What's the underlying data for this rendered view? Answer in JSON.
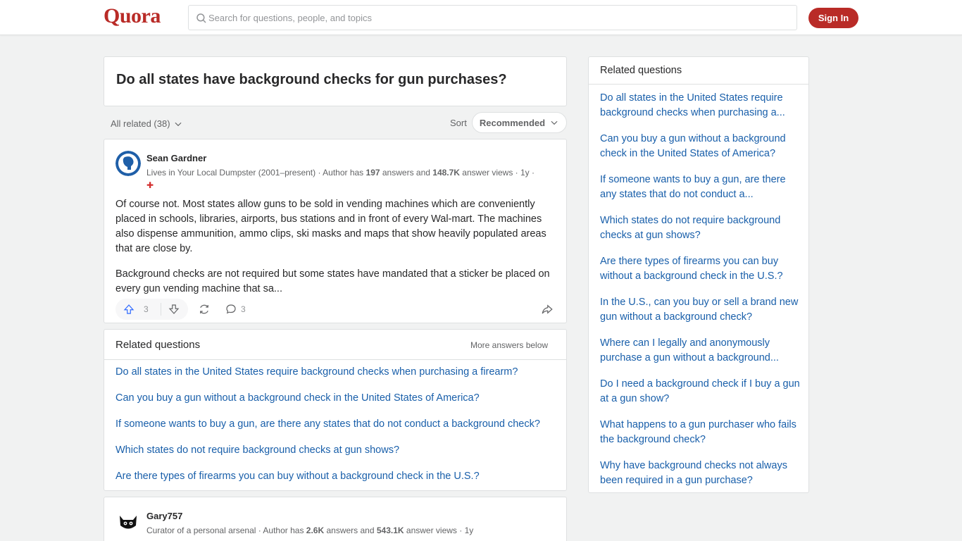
{
  "header": {
    "logo": "Quora",
    "search_placeholder": "Search for questions, people, and topics",
    "signin_label": "Sign In",
    "brand_color": "#b92b27"
  },
  "question": {
    "title": "Do all states have background checks for gun purchases?"
  },
  "filters": {
    "all_related": "All related (38)",
    "sort_label": "Sort",
    "sort_value": "Recommended"
  },
  "answer1": {
    "author": "Sean Gardner",
    "cred_prefix": "Lives in Your Local Dumpster (2001–present) · Author has ",
    "answers_count": "197",
    "cred_mid": " answers and ",
    "views_count": "148.7K",
    "cred_suffix": " answer views · 1y ·",
    "paragraph1": "Of course not. Most states allow guns to be sold in vending machines which are conveniently placed in schools, libraries, airports, bus stations and in front of every Wal-mart. The machines also dispense ammunition, ammo clips, ski masks and maps that show heavily populated areas that are close by.",
    "paragraph2": "Background checks are not required but some states have mandated that a sticker be placed on every gun vending machine that sa...",
    "upvotes": "3",
    "comments": "3"
  },
  "related_inline": {
    "title": "Related questions",
    "more_label": "More answers below",
    "items": [
      "Do all states in the United States require background checks when purchasing a firearm?",
      "Can you buy a gun without a background check in the United States of America?",
      "If someone wants to buy a gun, are there any states that do not conduct a background check?",
      "Which states do not require background checks at gun shows?",
      "Are there types of firearms you can buy without a background check in the U.S.?"
    ]
  },
  "answer2": {
    "author": "Gary757",
    "cred_prefix": "Curator of a personal arsenal · Author has ",
    "answers_count": "2.6K",
    "cred_mid": " answers and ",
    "views_count": "543.1K",
    "cred_suffix": " answer views · 1y"
  },
  "sidebar": {
    "title": "Related questions",
    "items": [
      "Do all states in the United States require background checks when purchasing a...",
      "Can you buy a gun without a background check in the United States of America?",
      "If someone wants to buy a gun, are there any states that do not conduct a...",
      "Which states do not require background checks at gun shows?",
      "Are there types of firearms you can buy without a background check in the U.S.?",
      "In the U.S., can you buy or sell a brand new gun without a background check?",
      "Where can I legally and anonymously purchase a gun without a background...",
      "Do I need a background check if I buy a gun at a gun show?",
      "What happens to a gun purchaser who fails the background check?",
      "Why have background checks not always been required in a gun purchase?"
    ]
  }
}
